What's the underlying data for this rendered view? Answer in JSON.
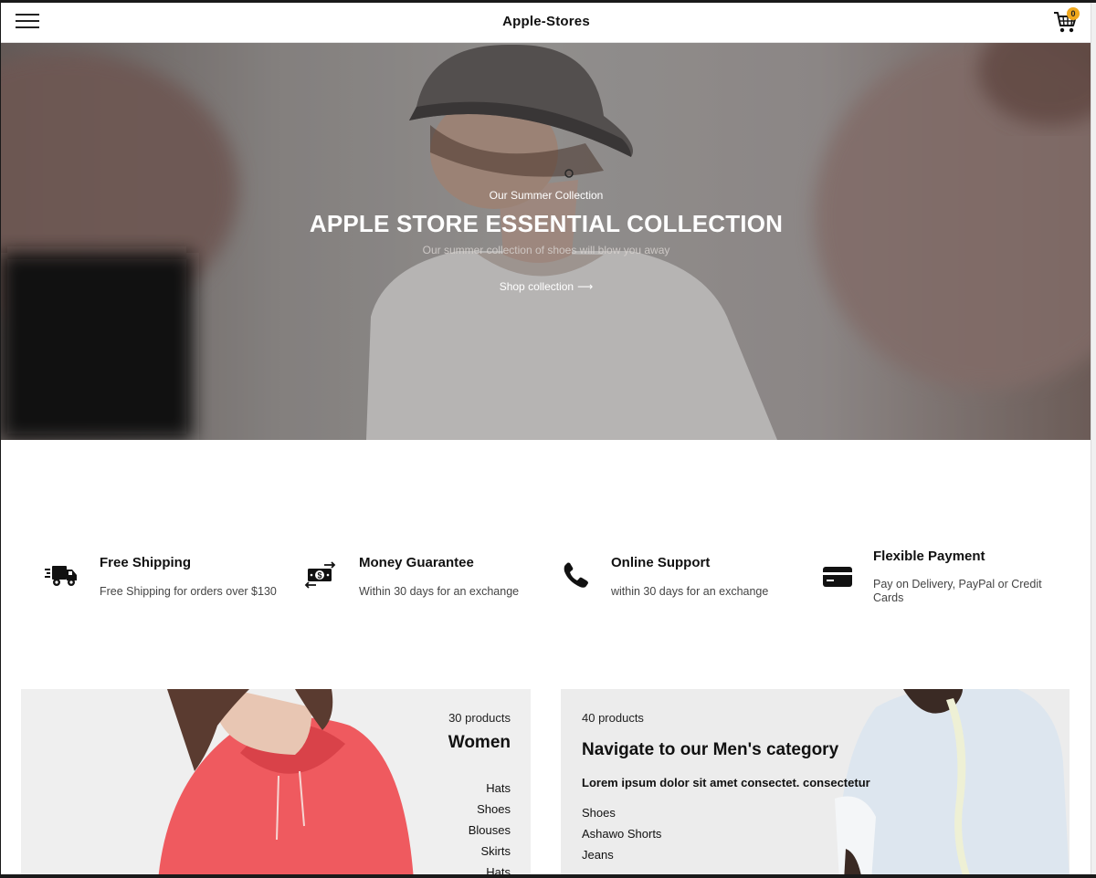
{
  "header": {
    "brand": "Apple-Stores",
    "cart_count": "0"
  },
  "hero": {
    "eyebrow": "Our Summer Collection",
    "title": "APPLE STORE ESSENTIAL COLLECTION",
    "subtitle": "Our summer collection of shoes will blow you away",
    "cta": "Shop collection",
    "cta_arrow": "⟶"
  },
  "features": [
    {
      "icon": "delivery-truck-icon",
      "title": "Free Shipping",
      "desc": "Free Shipping for orders over $130"
    },
    {
      "icon": "money-exchange-icon",
      "title": "Money Guarantee",
      "desc": "Within 30 days for an exchange"
    },
    {
      "icon": "phone-icon",
      "title": "Online Support",
      "desc": "within 30 days for an exchange"
    },
    {
      "icon": "credit-card-icon",
      "title": "Flexible Payment",
      "desc": "Pay on Delivery, PayPal or Credit Cards"
    }
  ],
  "categories": {
    "women": {
      "count": "30 products",
      "title": "Women",
      "links": [
        "Hats",
        "Shoes",
        "Blouses",
        "Skirts",
        "Hats"
      ]
    },
    "men": {
      "count": "40 products",
      "title": "Navigate to our Men's category",
      "lead": "Lorem ipsum dolor sit amet consectet. consectetur",
      "links": [
        "Shoes",
        "Ashawo Shorts",
        "Jeans"
      ]
    }
  },
  "colors": {
    "cart_badge": "#f0a81c",
    "women_hoodie": "#ef5a5f",
    "men_hoodie": "#dde6ef"
  }
}
